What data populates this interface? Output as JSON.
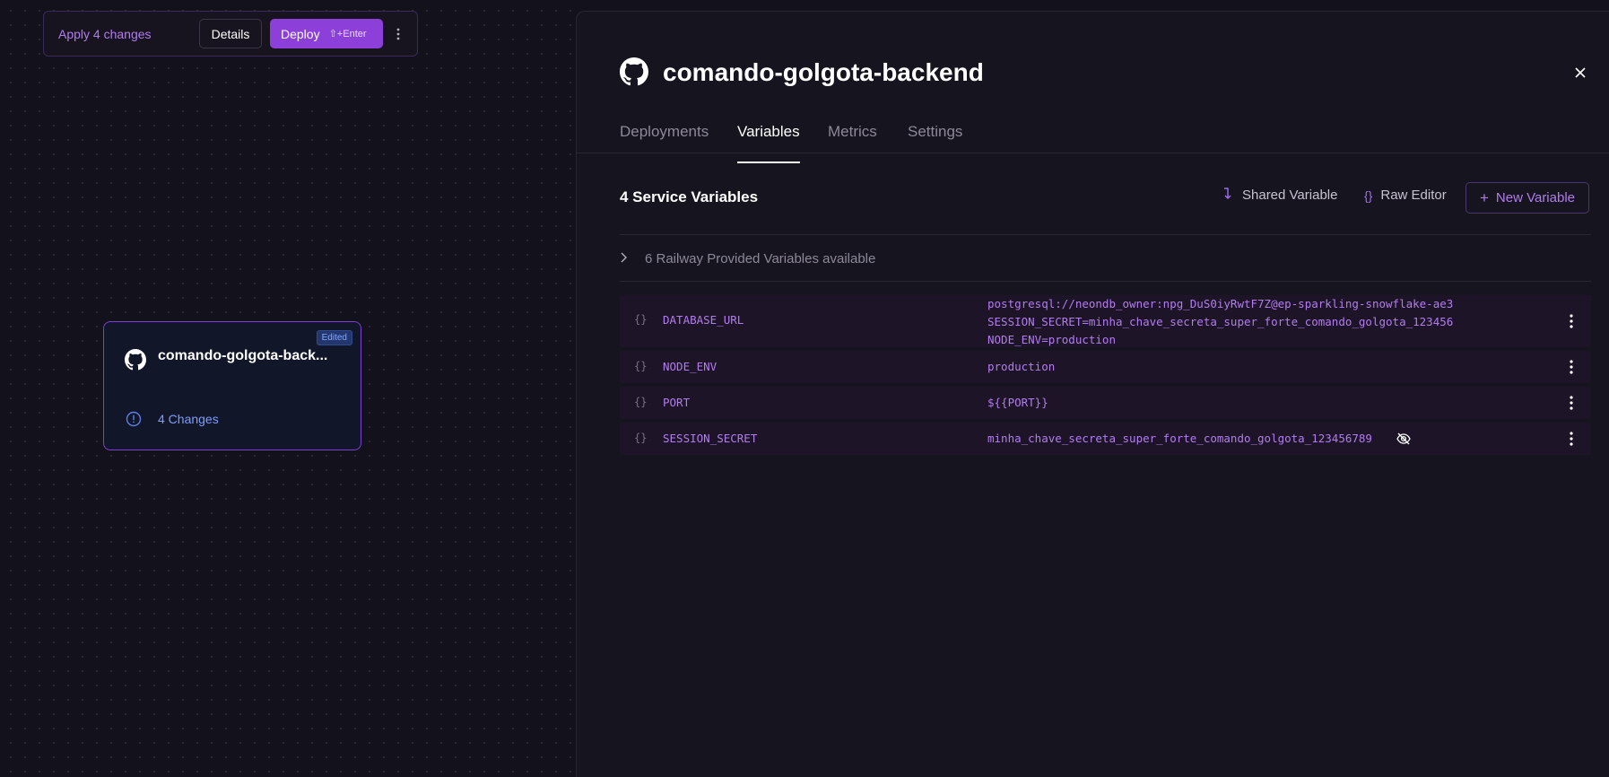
{
  "staging": {
    "apply_label": "Apply 4 changes",
    "details_label": "Details",
    "deploy_label": "Deploy",
    "deploy_shortcut": "⇧+Enter"
  },
  "service_card": {
    "title": "comando-golgota-back...",
    "badge": "Edited",
    "changes": "4 Changes"
  },
  "panel": {
    "title": "comando-golgota-backend",
    "tabs": [
      "Deployments",
      "Variables",
      "Metrics",
      "Settings"
    ],
    "active_tab": "Variables",
    "section_title": "4 Service Variables",
    "actions": {
      "shared_variable": "Shared Variable",
      "raw_editor": "Raw Editor",
      "new_variable": "New Variable"
    },
    "provided_label": "6 Railway Provided Variables available",
    "variables": [
      {
        "name": "DATABASE_URL",
        "value_lines": [
          "postgresql://neondb_owner:npg_DuS0iyRwtF7Z@ep-sparkling-snowflake-ae3",
          "SESSION_SECRET=minha_chave_secreta_super_forte_comando_golgota_123456",
          "NODE_ENV=production"
        ]
      },
      {
        "name": "NODE_ENV",
        "value": "production"
      },
      {
        "name": "PORT",
        "value": "${{PORT}}"
      },
      {
        "name": "SESSION_SECRET",
        "value": "minha_chave_secreta_super_forte_comando_golgota_123456789"
      }
    ]
  },
  "colors": {
    "accent": "#8d3fd9",
    "accent_text": "#b27cf0",
    "background": "#13111c",
    "panel": "#16141e",
    "card_border": "#7c3fd0",
    "changes_blue": "#7f9cff"
  }
}
